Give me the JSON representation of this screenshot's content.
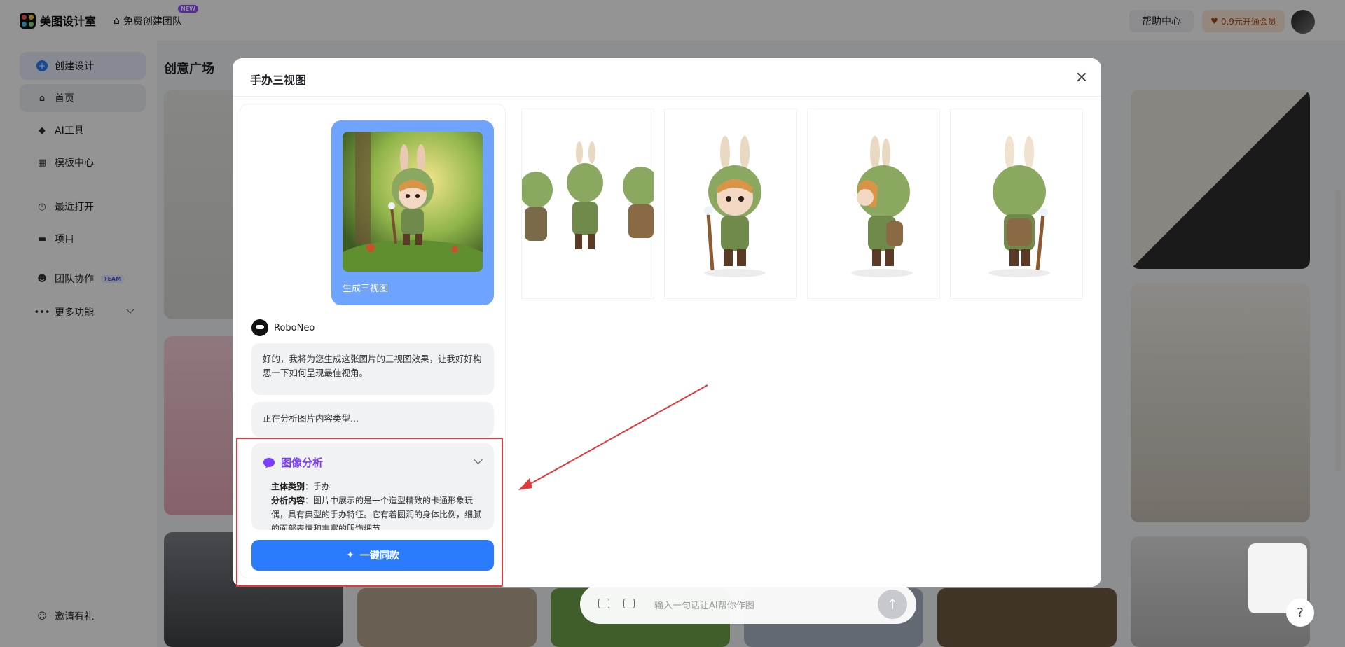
{
  "app": {
    "name": "美图设计室"
  },
  "topbar": {
    "create_team": "免费创建团队",
    "new_badge": "NEW",
    "help_label": "帮助中心",
    "vip_label": "0.9元开通会员"
  },
  "sidebar": {
    "create_label": "创建设计",
    "items": [
      {
        "label": "首页"
      },
      {
        "label": "AI工具"
      },
      {
        "label": "模板中心"
      },
      {
        "label": "最近打开"
      },
      {
        "label": "项目"
      },
      {
        "label": "团队协作"
      },
      {
        "label": "更多功能"
      }
    ],
    "team_badge": "TEAM",
    "invite_label": "邀请有礼"
  },
  "main": {
    "title": "创意广场"
  },
  "modal": {
    "title": "手办三视图",
    "user_message": "生成三视图",
    "bot_name": "RoboNeo",
    "bot_reply": "好的，我将为您生成这张图片的三视图效果，让我好好构思一下如何呈现最佳视角。",
    "status_text": "正在分析图片内容类型...",
    "analysis": {
      "title": "图像分析",
      "category_label": "主体类别",
      "category_value": "手办",
      "content_label": "分析内容",
      "content_value": "图片中展示的是一个造型精致的卡通形象玩偶，具有典型的手办特征。它有着圆润的身体比例，细腻的面部表情和丰富的服饰细节"
    },
    "one_click_label": "一键同款"
  },
  "prompt": {
    "placeholder": "输入一句话让AI帮你作图"
  },
  "colors": {
    "accent": "#2b7bff",
    "user_bubble": "#6ea3ff",
    "analysis": "#7a3cff",
    "highlight": "#e23a3a"
  },
  "floating": {
    "help_label": "?"
  }
}
